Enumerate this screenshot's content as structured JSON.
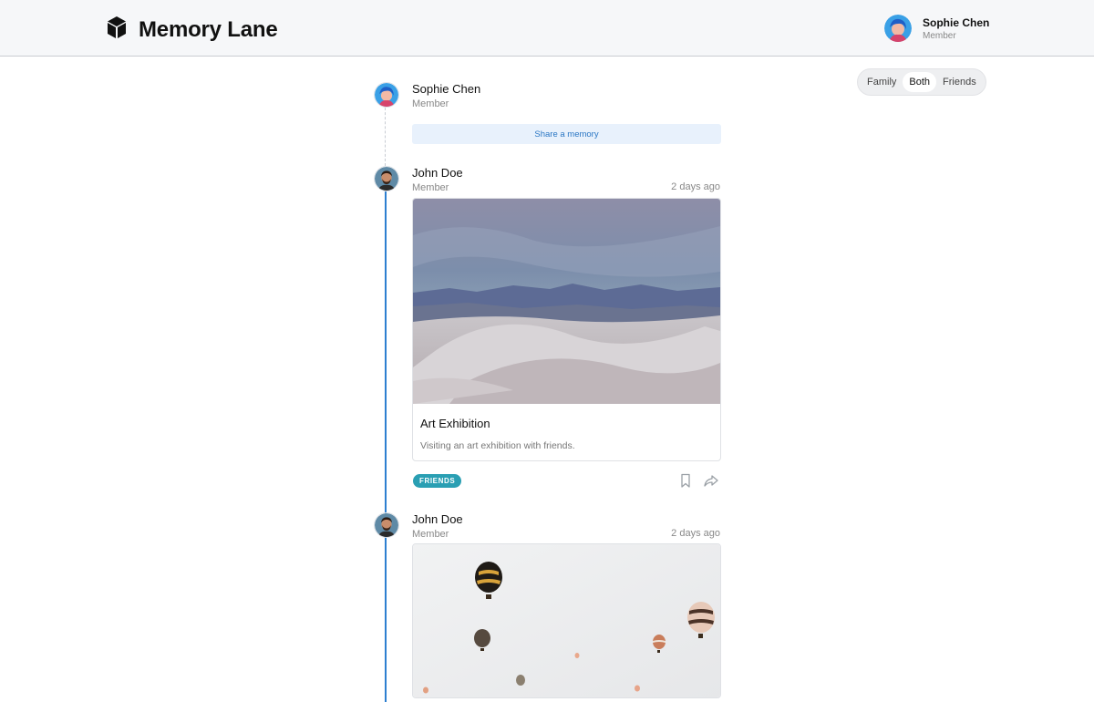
{
  "app": {
    "title": "Memory Lane"
  },
  "header": {
    "user": {
      "name": "Sophie Chen",
      "role": "Member"
    }
  },
  "filter": {
    "options": [
      "Family",
      "Both",
      "Friends"
    ],
    "selected": "Both"
  },
  "composer": {
    "name": "Sophie Chen",
    "role": "Member",
    "share_label": "Share a memory"
  },
  "posts": [
    {
      "author": "John Doe",
      "role": "Member",
      "time": "2 days ago",
      "title": "Art Exhibition",
      "description": "Visiting an art exhibition with friends.",
      "tag": "FRIENDS"
    },
    {
      "author": "John Doe",
      "role": "Member",
      "time": "2 days ago"
    }
  ],
  "colors": {
    "accent": "#2d7fd0",
    "tag": "#2a9fb3",
    "share_bg": "#e8f1fc"
  },
  "icons": [
    "cube-logo-icon",
    "bookmark-icon",
    "share-icon"
  ]
}
